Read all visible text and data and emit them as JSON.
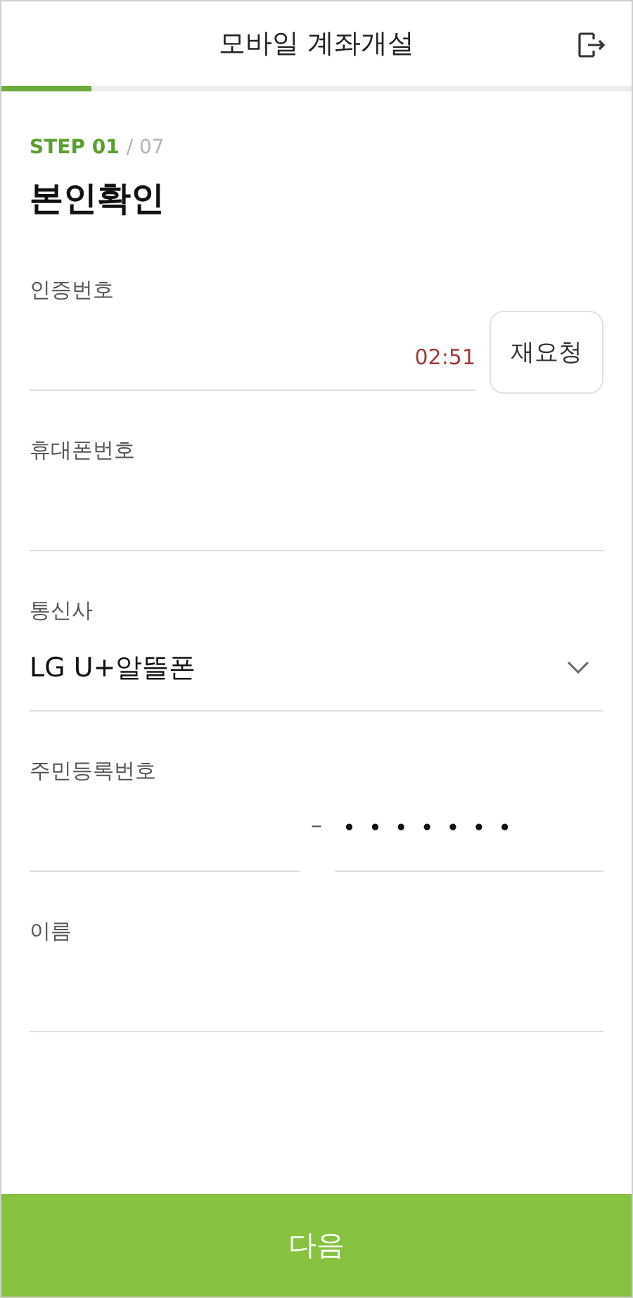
{
  "header": {
    "title": "모바일 계좌개설"
  },
  "progress": {
    "level": 0.143
  },
  "step": {
    "current": "STEP 01",
    "total": "/ 07"
  },
  "page_title": "본인확인",
  "fields": [
    {
      "kind": "code",
      "label": "인증번호",
      "timer": "02:51",
      "button": "재요청"
    },
    {
      "kind": "text",
      "label": "휴대폰번호"
    },
    {
      "kind": "select",
      "label": "통신사",
      "value": "LG U+알뜰폰"
    },
    {
      "kind": "rrn",
      "label": "주민등록번호",
      "separator": "–",
      "masked": "•••••••"
    },
    {
      "kind": "text",
      "label": "이름"
    }
  ],
  "next_button": "다음"
}
